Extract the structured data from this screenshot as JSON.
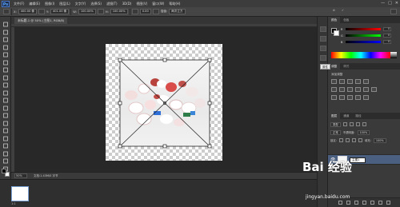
{
  "app": {
    "logo": "Ps"
  },
  "menubar": {
    "items": [
      "文件(F)",
      "编辑(E)",
      "图像(I)",
      "图层(L)",
      "文字(Y)",
      "选择(S)",
      "滤镜(T)",
      "3D(D)",
      "视图(V)",
      "窗口(W)",
      "帮助(H)"
    ],
    "window_controls": [
      "—",
      "□",
      "✕"
    ]
  },
  "options_bar": {
    "x_label": "X:",
    "x_value": "400.00 像",
    "y_label": "Y:",
    "y_value": "401.00 像",
    "w_label": "W:",
    "w_value": "100.00%",
    "h_label": "H:",
    "h_value": "100.00%",
    "angle_value": "0.00",
    "interp_label": "插值:",
    "interp_value": "两次立方",
    "right_labels": [
      "⊘",
      "✓"
    ]
  },
  "document": {
    "tab_title": "未标题-1 @ 50% (主图1, RGB/8)",
    "zoom": "50%",
    "info": "文档:1.43M/0 字节"
  },
  "bottom_panel": {
    "thumb_label": "1:1"
  },
  "dock": {
    "tooltip": "属性"
  },
  "color_panel": {
    "tabs": [
      "颜色",
      "色板"
    ],
    "sliders": [
      {
        "letter": "R",
        "value": "0",
        "gradient": "#000000,#ff0000"
      },
      {
        "letter": "G",
        "value": "0",
        "gradient": "#000000,#00ff00"
      },
      {
        "letter": "B",
        "value": "0",
        "gradient": "#000000,#0000ff"
      }
    ]
  },
  "adjustments_panel": {
    "tabs": [
      "调整",
      "样式"
    ],
    "title": "添加调整"
  },
  "layers_panel": {
    "tabs": [
      "图层",
      "通道",
      "路径"
    ],
    "kind_label": "类型",
    "blend_mode": "正常",
    "opacity_label": "不透明度:",
    "opacity_value": "100%",
    "lock_label": "锁定:",
    "fill_label": "填充:",
    "fill_value": "100%",
    "layer_name": "主图1"
  },
  "watermark": {
    "main": "Bai 经验",
    "url": "jingyan.baidu.com"
  }
}
